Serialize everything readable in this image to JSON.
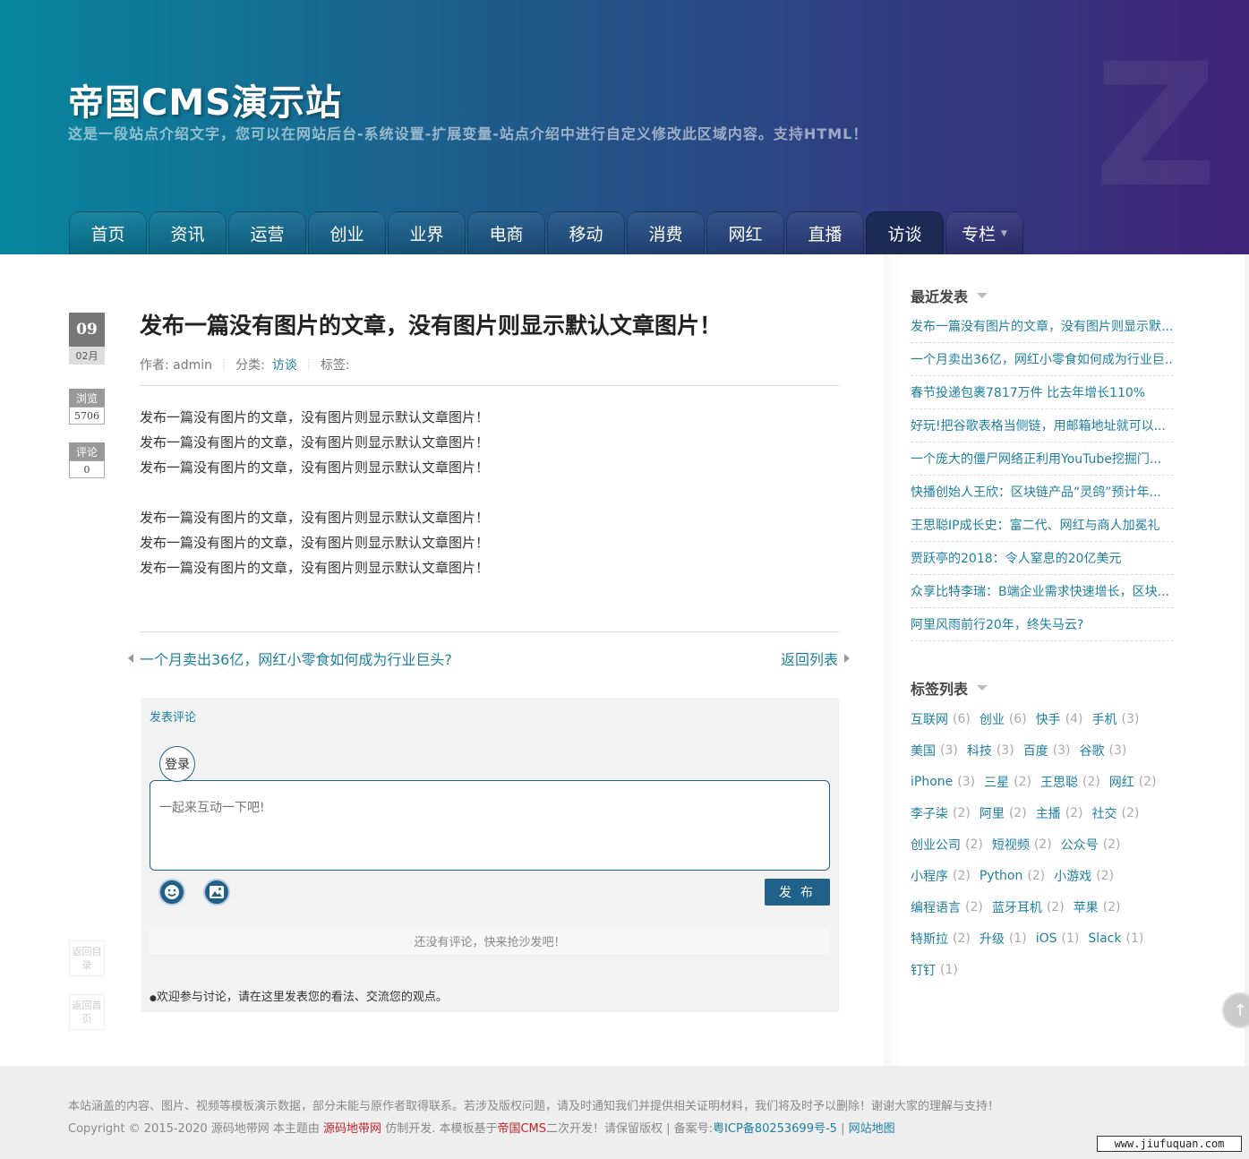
{
  "site": {
    "title": "帝国CMS演示站",
    "description": "这是一段站点介绍文字，您可以在网站后台-系统设置-扩展变量-站点介绍中进行自定义修改此区域内容。支持HTML！"
  },
  "nav": [
    {
      "label": "首页"
    },
    {
      "label": "资讯"
    },
    {
      "label": "运营"
    },
    {
      "label": "创业"
    },
    {
      "label": "业界"
    },
    {
      "label": "电商"
    },
    {
      "label": "移动"
    },
    {
      "label": "消费"
    },
    {
      "label": "网红"
    },
    {
      "label": "直播"
    },
    {
      "label": "访谈"
    },
    {
      "label": "专栏"
    }
  ],
  "date": {
    "day": "09",
    "month": "02月"
  },
  "stats": {
    "views_label": "浏览",
    "views": "5706",
    "comments_label": "评论",
    "comments": "0"
  },
  "side_buttons": {
    "back_catalog": "返回目录",
    "back_home": "返回首页"
  },
  "article": {
    "title": "发布一篇没有图片的文章，没有图片则显示默认文章图片！",
    "author_label": "作者: admin",
    "category_label": "分类:",
    "category": "访谈",
    "tags_label": "标签:",
    "paragraphs": [
      "发布一篇没有图片的文章，没有图片则显示默认文章图片！",
      "发布一篇没有图片的文章，没有图片则显示默认文章图片！",
      "发布一篇没有图片的文章，没有图片则显示默认文章图片！",
      "发布一篇没有图片的文章，没有图片则显示默认文章图片！",
      "发布一篇没有图片的文章，没有图片则显示默认文章图片！",
      "发布一篇没有图片的文章，没有图片则显示默认文章图片！"
    ],
    "prev": "一个月卖出36亿，网红小零食如何成为行业巨头?",
    "back_list": "返回列表"
  },
  "comment": {
    "title": "发表评论",
    "login": "登录",
    "placeholder": "一起来互动一下吧!",
    "submit": "发 布",
    "empty": "还没有评论，快来抢沙发吧！",
    "welcome": "欢迎参与讨论，请在这里发表您的看法、交流您的观点。"
  },
  "sidebar": {
    "recent_title": "最近发表",
    "recent": [
      "发布一篇没有图片的文章，没有图片则显示默...",
      "一个月卖出36亿，网红小零食如何成为行业巨...",
      "春节投递包裹7817万件 比去年增长110%",
      "好玩!把谷歌表格当侧链，用邮箱地址就可以...",
      "一个庞大的僵尸网络正利用YouTube挖掘门...",
      "快播创始人王欣：区块链产品“灵鸽”预计年...",
      "王思聪IP成长史：富二代、网红与商人加冕礼",
      "贾跃亭的2018：令人窒息的20亿美元",
      "众享比特李瑞：B端企业需求快速增长，区块...",
      "阿里风雨前行20年，终失马云?"
    ],
    "tags_title": "标签列表",
    "tags": [
      {
        "name": "互联网",
        "count": "(6)"
      },
      {
        "name": "创业",
        "count": "(6)"
      },
      {
        "name": "快手",
        "count": "(4)"
      },
      {
        "name": "手机",
        "count": "(3)"
      },
      {
        "name": "美国",
        "count": "(3)"
      },
      {
        "name": "科技",
        "count": "(3)"
      },
      {
        "name": "百度",
        "count": "(3)"
      },
      {
        "name": "谷歌",
        "count": "(3)"
      },
      {
        "name": "iPhone",
        "count": "(3)"
      },
      {
        "name": "三星",
        "count": "(2)"
      },
      {
        "name": "王思聪",
        "count": "(2)"
      },
      {
        "name": "网红",
        "count": "(2)"
      },
      {
        "name": "李子柒",
        "count": "(2)"
      },
      {
        "name": "阿里",
        "count": "(2)"
      },
      {
        "name": "主播",
        "count": "(2)"
      },
      {
        "name": "社交",
        "count": "(2)"
      },
      {
        "name": "创业公司",
        "count": "(2)"
      },
      {
        "name": "短视频",
        "count": "(2)"
      },
      {
        "name": "公众号",
        "count": "(2)"
      },
      {
        "name": "小程序",
        "count": "(2)"
      },
      {
        "name": "Python",
        "count": "(2)"
      },
      {
        "name": "小游戏",
        "count": "(2)"
      },
      {
        "name": "编程语言",
        "count": "(2)"
      },
      {
        "name": "蓝牙耳机",
        "count": "(2)"
      },
      {
        "name": "苹果",
        "count": "(2)"
      },
      {
        "name": "特斯拉",
        "count": "(2)"
      },
      {
        "name": "升级",
        "count": "(1)"
      },
      {
        "name": "iOS",
        "count": "(1)"
      },
      {
        "name": "Slack",
        "count": "(1)"
      },
      {
        "name": "钉钉",
        "count": "(1)"
      }
    ]
  },
  "footer": {
    "line1": "本站涵盖的内容、图片、视频等模板演示数据，部分未能与原作者取得联系。若涉及版权问题，请及时通知我们并提供相关证明材料，我们将及时予以删除！谢谢大家的理解与支持！",
    "copy_prefix": "Copyright © 2015-2020 源码地带网 本主题由 ",
    "copy_brand": "源码地带网",
    "copy_mid": " 仿制开发. 本模板基于",
    "copy_cms": "帝国CMS",
    "copy_after": "二次开发！请保留版权 | 备案号:",
    "icp": "粤ICP备80253699号-5",
    "sep": " | ",
    "sitemap": "网站地图"
  },
  "watermark": "www.jiufuquan.com"
}
